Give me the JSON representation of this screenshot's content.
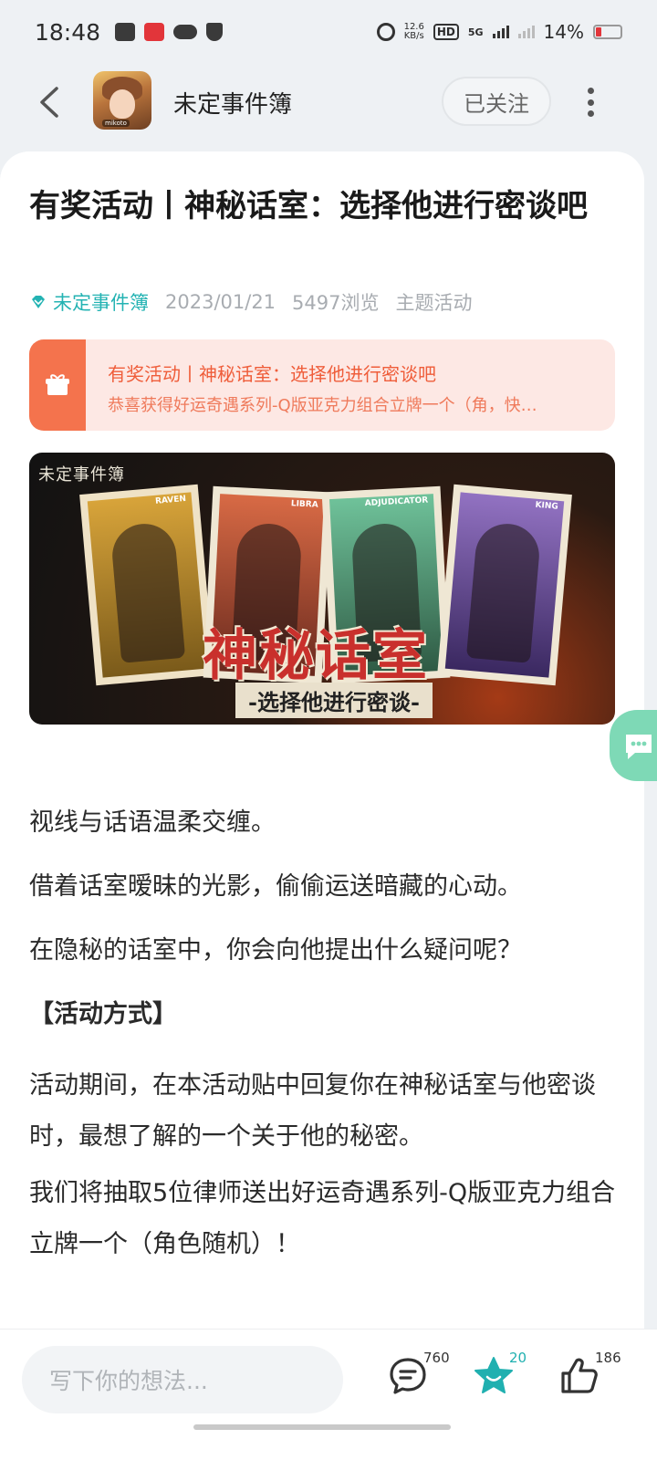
{
  "status_bar": {
    "time": "18:48",
    "net_speed_value": "12.6",
    "net_speed_unit": "KB/s",
    "hd_label": "HD",
    "signal_label": "5G",
    "battery": "14%"
  },
  "header": {
    "channel_name": "未定事件簿",
    "follow_label": "已关注",
    "avatar_tag": "mikoto"
  },
  "post": {
    "title": "有奖活动丨神秘话室：选择他进行密谈吧",
    "author": "未定事件簿",
    "date": "2023/01/21",
    "views": "5497浏览",
    "category": "主题活动",
    "prize": {
      "title": "有奖活动丨神秘话室：选择他进行密谈吧",
      "subtitle": "恭喜获得好运奇遇系列-Q版亚克力组合立牌一个（角，快…"
    },
    "banner": {
      "logo": "未定事件簿",
      "cards": [
        "RAVEN",
        "LIBRA",
        "ADJUDICATOR",
        "KING"
      ],
      "headline": "神秘话室",
      "subline": "-选择他进行密谈-"
    },
    "paragraphs": {
      "p1": "视线与话语温柔交缠。",
      "p2": "借着话室暧昧的光影，偷偷运送暗藏的心动。",
      "p3": " 在隐秘的话室中，你会向他提出什么疑问呢？",
      "heading": "【活动方式】",
      "p4": "活动期间，在本活动贴中回复你在神秘话室与他密谈时，最想了解的一个关于他的秘密。",
      "p5": "我们将抽取5位律师送出好运奇遇系列-Q版亚克力组合立牌一个（角色随机）！"
    }
  },
  "bottom_bar": {
    "comment_placeholder": "写下你的想法...",
    "comment_count": "760",
    "favorite_count": "20",
    "like_count": "186"
  },
  "colors": {
    "accent": "#24b3b3",
    "prize_bg": "#fde8e4",
    "prize_accent": "#f4734d",
    "chat_fab": "#7ed9b6"
  }
}
